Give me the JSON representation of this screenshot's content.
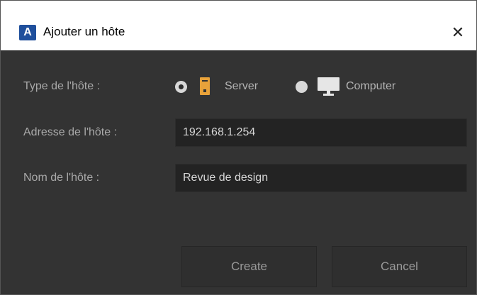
{
  "window": {
    "title": "Ajouter un hôte",
    "app_icon_letter": "A",
    "close_glyph": "✕"
  },
  "form": {
    "type_label": "Type de l'hôte :",
    "type_options": [
      {
        "label": "Server",
        "selected": true,
        "icon": "server-icon"
      },
      {
        "label": "Computer",
        "selected": false,
        "icon": "monitor-icon"
      }
    ],
    "address_label": "Adresse de l'hôte :",
    "address_value": "192.168.1.254",
    "name_label": "Nom de l'hôte :",
    "name_value": "Revue de design"
  },
  "buttons": {
    "create": "Create",
    "cancel": "Cancel"
  },
  "colors": {
    "background": "#333333",
    "titlebar": "#ffffff",
    "server_icon": "#e8a23a",
    "app_icon": "#1f4f9c"
  }
}
